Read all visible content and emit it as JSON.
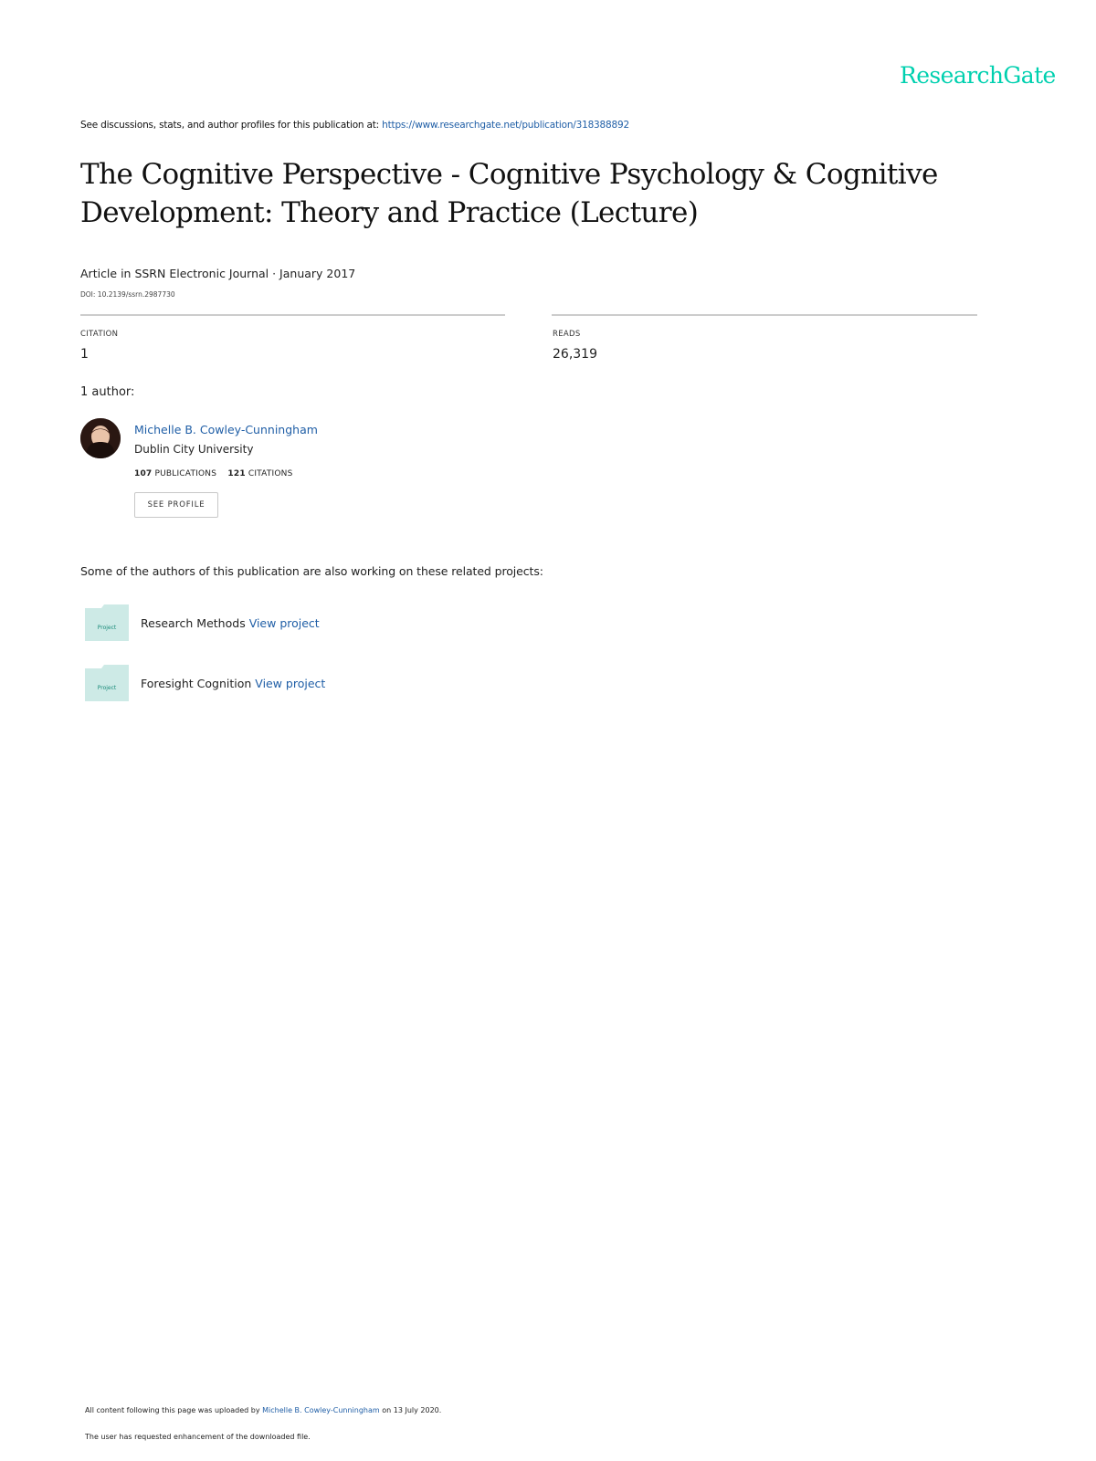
{
  "header": {
    "brand": "ResearchGate",
    "see_text": "See discussions, stats, and author profiles for this publication at: ",
    "see_link": "https://www.researchgate.net/publication/318388892"
  },
  "publication": {
    "title": "The Cognitive Perspective - Cognitive Psychology & Cognitive Development: Theory and Practice (Lecture)",
    "meta": "Article  in  SSRN Electronic Journal · January 2017",
    "doi": "DOI: 10.2139/ssrn.2987730"
  },
  "stats": {
    "citation_label": "CITATION",
    "citation_value": "1",
    "reads_label": "READS",
    "reads_value": "26,319"
  },
  "authors": {
    "count_label": "1 author:",
    "name": "Michelle B. Cowley-Cunningham",
    "institution": "Dublin City University",
    "publications_count": "107",
    "publications_label": "PUBLICATIONS",
    "citations_count": "121",
    "citations_label": "CITATIONS",
    "see_profile": "SEE PROFILE"
  },
  "projects": {
    "intro": "Some of the authors of this publication are also working on these related projects:",
    "icon_label": "Project",
    "view_label": "View project",
    "items": [
      {
        "name": "Research Methods "
      },
      {
        "name": "Foresight Cognition "
      }
    ]
  },
  "footer": {
    "prefix": "All content following this page was uploaded by ",
    "uploader": "Michelle B. Cowley-Cunningham",
    "suffix": " on 13 July 2020.",
    "note": "The user has requested enhancement of the downloaded file."
  },
  "colors": {
    "brand": "#00d0af",
    "link": "#1f5ea6",
    "project_icon": "#cdeae6"
  }
}
